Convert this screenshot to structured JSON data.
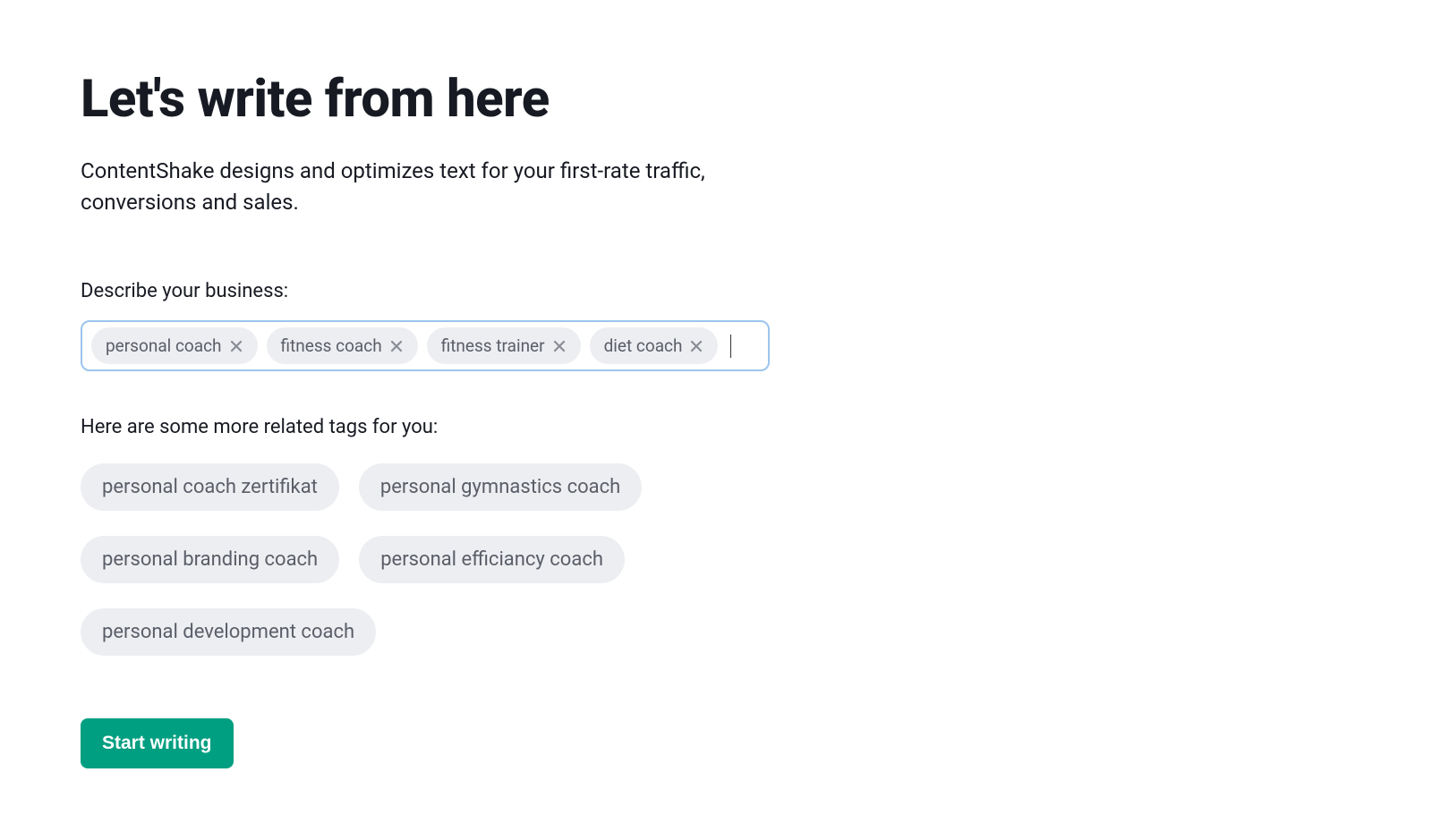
{
  "heading": "Let's write from here",
  "subheading": "ContentShake designs and optimizes text for your first-rate traffic, conversions and sales.",
  "describe_label": "Describe your business:",
  "selected_tags": [
    "personal coach",
    "fitness coach",
    "fitness trainer",
    "diet coach"
  ],
  "suggested_label": "Here are some more related tags for you:",
  "suggested_tags": [
    "personal coach zertifikat",
    "personal gymnastics coach",
    "personal branding coach",
    "personal efficiancy coach",
    "personal development coach"
  ],
  "cta_label": "Start writing"
}
